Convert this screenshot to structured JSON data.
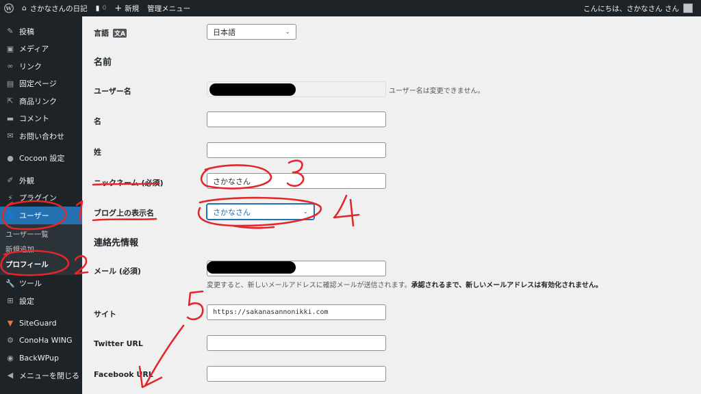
{
  "adminbar": {
    "site_name": "さかなさんの日記",
    "comments_count": "0",
    "new_label": "新規",
    "admin_menu_label": "管理メニュー",
    "greeting": "こんにちは、さかなさん さん"
  },
  "sidebar": {
    "items": [
      {
        "label": "投稿",
        "icon": "pin-icon"
      },
      {
        "label": "メディア",
        "icon": "media-icon"
      },
      {
        "label": "リンク",
        "icon": "link-icon"
      },
      {
        "label": "固定ページ",
        "icon": "page-icon"
      },
      {
        "label": "商品リンク",
        "icon": "share-icon"
      },
      {
        "label": "コメント",
        "icon": "comment-icon"
      },
      {
        "label": "お問い合わせ",
        "icon": "mail-icon"
      },
      {
        "label": "Cocoon 設定",
        "icon": "circle-icon"
      },
      {
        "label": "外観",
        "icon": "brush-icon"
      },
      {
        "label": "プラグイン",
        "icon": "plugin-icon"
      },
      {
        "label": "ユーザー",
        "icon": "user-icon"
      }
    ],
    "sub_items": [
      "ユーザー一覧",
      "新規追加",
      "プロフィール"
    ],
    "bottom_items": [
      {
        "label": "ツール",
        "icon": "wrench-icon"
      },
      {
        "label": "設定",
        "icon": "settings-icon"
      },
      {
        "label": "SiteGuard",
        "icon": "siteguard-icon"
      },
      {
        "label": "ConoHa WING",
        "icon": "gear-icon"
      },
      {
        "label": "BackWPup",
        "icon": "backwpup-icon"
      },
      {
        "label": "メニューを閉じる",
        "icon": "collapse-icon"
      }
    ]
  },
  "form": {
    "language_label": "言語",
    "language_value": "日本語",
    "name_section": "名前",
    "username_label": "ユーザー名",
    "username_desc": "ユーザー名は変更できません。",
    "first_name_label": "名",
    "last_name_label": "姓",
    "nickname_label": "ニックネーム (必須)",
    "nickname_value": "さかなさん",
    "display_name_label": "ブログ上の表示名",
    "display_name_value": "さかなさん",
    "contact_section": "連絡先情報",
    "email_label": "メール (必須)",
    "email_desc_normal": "変更すると、新しいメールアドレスに確認メールが送信されます。",
    "email_desc_bold": "承認されるまで、新しいメールアドレスは有効化されません。",
    "site_label": "サイト",
    "site_value": "https://sakanasannonikki.com",
    "twitter_label": "Twitter URL",
    "facebook_label": "Facebook URL"
  },
  "annotations": {
    "numbers": [
      "1",
      "2",
      "3",
      "4",
      "5"
    ],
    "color": "#e3262b"
  },
  "colors": {
    "adminbar_bg": "#1d2327",
    "active_menu": "#2271b1",
    "content_bg": "#f0f0f1"
  }
}
